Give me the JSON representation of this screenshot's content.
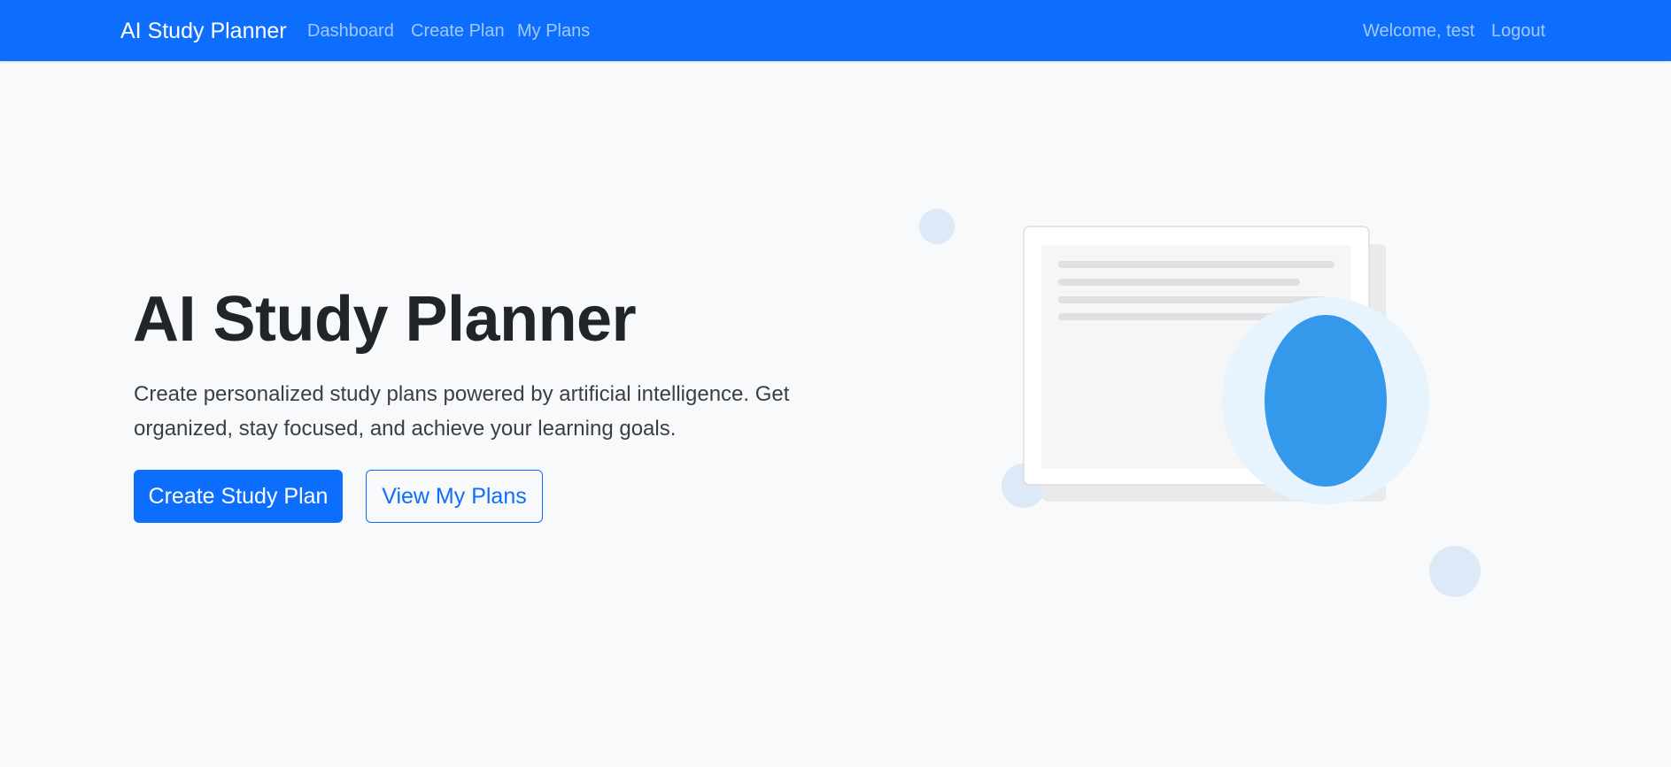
{
  "navbar": {
    "brand": "AI Study Planner",
    "links": [
      "Dashboard",
      "Create Plan",
      "My Plans"
    ],
    "welcome": "Welcome, test",
    "logout": "Logout"
  },
  "hero": {
    "title": "AI Study Planner",
    "lead": "Create personalized study plans powered by artificial intelligence. Get organized, stay focused, and achieve your learning goals.",
    "primary_button": "Create Study Plan",
    "secondary_button": "View My Plans"
  },
  "colors": {
    "primary": "#0d6efd",
    "background": "#f8f9fa",
    "illustration_accent": "#3498eb"
  }
}
